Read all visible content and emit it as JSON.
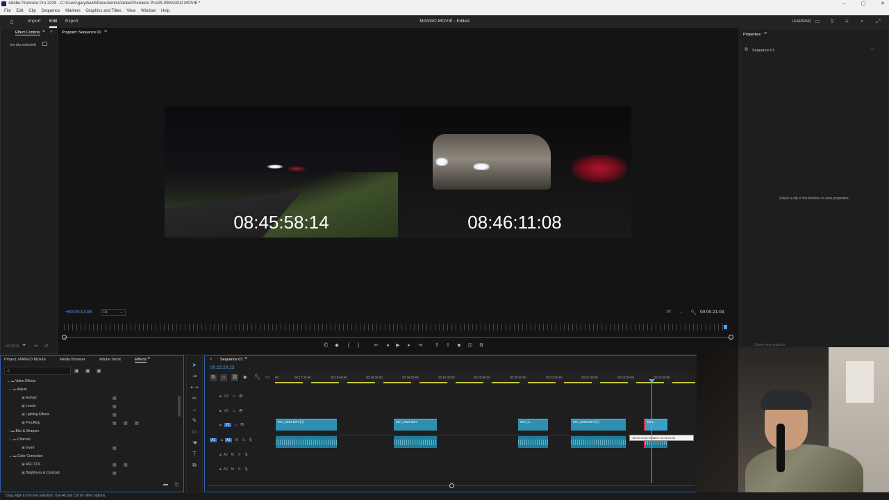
{
  "window": {
    "title": "Adobe Premiere Pro 2025 - C:\\Users\\garydavid\\Documents\\Adobe\\Premiere Pro\\25.0\\MANGO MOVIE *",
    "menu": [
      "File",
      "Edit",
      "Clip",
      "Sequence",
      "Markers",
      "Graphics and Titles",
      "View",
      "Window",
      "Help"
    ]
  },
  "header": {
    "tabs": [
      "Import",
      "Edit",
      "Export"
    ],
    "active_tab": "Edit",
    "project_title": "MANGO MOVIE - Edited",
    "learning": "LEARNING"
  },
  "effect_controls": {
    "tab": "Effect Controls",
    "empty": "(no clip selected)",
    "timecode": "00:22:20"
  },
  "program": {
    "tab": "Program: Sequence 01",
    "left_timecode": "08:45:58:14",
    "right_timecode": "08:46:11:08",
    "playhead_timecode": "+00:00:13:08",
    "fit": "Fit",
    "resolution": "1/2",
    "duration": "00:00:21:04"
  },
  "properties": {
    "tab": "Properties",
    "sequence": "Sequence 01",
    "hint": "Select a clip in the timeline to view properties.",
    "cutoff": "Create new graphics"
  },
  "project_panel": {
    "tabs": [
      "Project: MANGO MOVIE",
      "Media Browser",
      "Adobe Stock",
      "Effects"
    ],
    "active": "Effects",
    "tree": [
      {
        "label": "Video Effects",
        "level": 0
      },
      {
        "label": "Adjust",
        "level": 1
      },
      {
        "label": "Extract",
        "level": 2
      },
      {
        "label": "Levels",
        "level": 2
      },
      {
        "label": "Lighting Effects",
        "level": 2
      },
      {
        "label": "ProcAmp",
        "level": 2
      },
      {
        "label": "Blur & Sharpen",
        "level": 1
      },
      {
        "label": "Channel",
        "level": 1
      },
      {
        "label": "Invert",
        "level": 2
      },
      {
        "label": "Color Correction",
        "level": 1
      },
      {
        "label": "ASC CDL",
        "level": 2
      },
      {
        "label": "Brightness & Contrast",
        "level": 2
      }
    ]
  },
  "timeline": {
    "tab": "Sequence 01",
    "timecode": "00:22:20:23",
    "ruler": [
      "00:17:30:00",
      "00:18:00:00",
      "00:18:30:00",
      "00:19:00:00",
      "00:19:30:00",
      "00:20:00:00",
      "00:20:30:00",
      "00:21:00:00",
      "00:21:30:00",
      "00:22:00:00",
      "00:22:30:00"
    ],
    "tracks": [
      "V3",
      "V2",
      "V1",
      "A1",
      "A2",
      "A3"
    ],
    "clips": [
      "MVI_0021.MP4 [V]",
      "MVI_0022.MP4",
      "MVI_0...",
      "MVI_0026.MP4 [V]",
      "MVI..."
    ],
    "tooltip": "+00:00:13:08 Duration: 00:00:21:04"
  },
  "status": {
    "text": "Drag edge to trim the selection. Use Alt and Ctrl for other options."
  },
  "colors": {
    "accent": "#2d8ceb",
    "clip_video": "#2f8fb0",
    "clip_audio": "#1e7d9a",
    "playhead": "#4aa3ff"
  }
}
